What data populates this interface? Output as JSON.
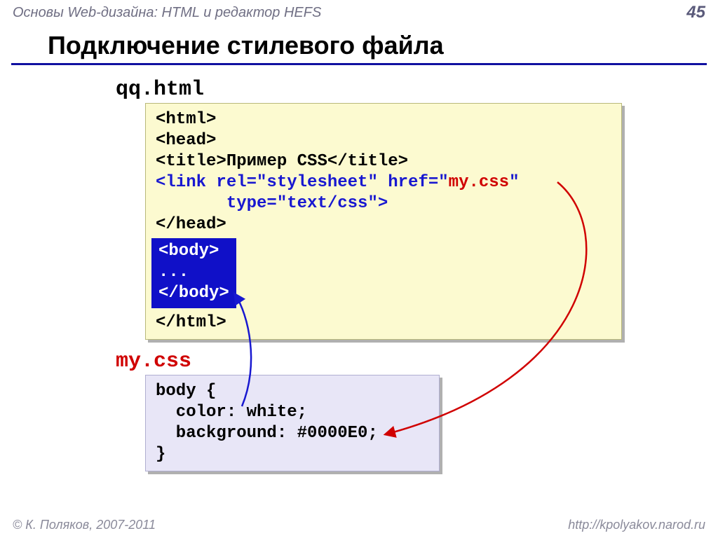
{
  "header": {
    "topic": "Основы Web-дизайна: HTML и редактор HEFS",
    "page_number": "45"
  },
  "title": "Подключение стилевого файла",
  "html_file": {
    "filename": "qq.html",
    "line1": "<html>",
    "line2": "<head>",
    "line3_open": "<title>",
    "line3_text": "Пример CSS",
    "line3_close": "</title>",
    "link_part1": "<link rel=\"stylesheet\" href=\"",
    "link_href": "my.css",
    "link_part2": "\"",
    "link_indent": "       type=\"text/css\">",
    "line5": "</head>",
    "body_open": "<body>",
    "body_dots": "...",
    "body_close": "</body>",
    "line7": "</html>"
  },
  "css_file": {
    "filename": "my.css",
    "line1": "body {",
    "line2": "  color: white;",
    "line3": "  background: #0000E0;",
    "line4": "}"
  },
  "footer": {
    "copyright": "© К. Поляков, 2007-2011",
    "url": "http://kpolyakov.narod.ru"
  }
}
